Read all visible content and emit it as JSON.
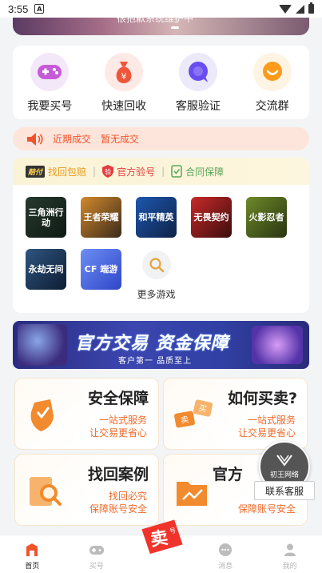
{
  "status_bar": {
    "time": "3:55",
    "notification_icon": "A"
  },
  "hero": {
    "text": "很抱歉系统维护中",
    "indicator": "carousel-dot"
  },
  "quick_actions": [
    {
      "label": "我要买号",
      "icon": "gamepad-icon",
      "color": "#c55bd8"
    },
    {
      "label": "快速回收",
      "icon": "money-bag-icon",
      "color": "#f0553a"
    },
    {
      "label": "客服验证",
      "icon": "chat-bubble-icon",
      "color": "#6a4cf0"
    },
    {
      "label": "交流群",
      "icon": "smile-chat-icon",
      "color": "#fb9b1c"
    }
  ],
  "recent_deals": {
    "label": "近期成交",
    "status": "暂无成交"
  },
  "guarantee": {
    "tag": "赔付",
    "items": [
      "找回包赔",
      "官方验号",
      "合同保障"
    ]
  },
  "games": [
    {
      "name": "三角洲行动",
      "color": "#1d2b24"
    },
    {
      "name": "王者荣耀",
      "color": "#3a2a1c"
    },
    {
      "name": "和平精英",
      "color": "#16305a"
    },
    {
      "name": "无畏契约",
      "color": "#7a1b1b"
    },
    {
      "name": "火影忍者",
      "color": "#3a4a1d"
    },
    {
      "name": "永劫无间",
      "color": "#1e3552"
    },
    {
      "name": "CF 端游",
      "color": "#3a5bd8"
    }
  ],
  "more_games": {
    "label": "更多游戏",
    "icon": "search-icon"
  },
  "banner": {
    "title": "官方交易 资金保障",
    "subtitle": "客户第一 品质至上"
  },
  "info_cards": [
    {
      "title": "安全保障",
      "line1": "一站式服务",
      "line2": "让交易更省心",
      "icon": "shield-icon"
    },
    {
      "title": "如何买卖?",
      "line1": "一站式服务",
      "line2": "让交易更省心",
      "icon": "trade-icon"
    },
    {
      "title": "找回案例",
      "line1": "找回必究",
      "line2": "保障账号安全",
      "icon": "magnifier-doc-icon"
    },
    {
      "title": "官方",
      "line1": "",
      "line2": "保障账号安全",
      "icon": "folder-icon"
    }
  ],
  "floating_service": {
    "logo_text": "初王网络",
    "button": "联系客服"
  },
  "tabbar": {
    "items": [
      {
        "label": "首页",
        "icon": "home-icon"
      },
      {
        "label": "买号",
        "icon": "gamepad-icon"
      },
      {
        "label": "卖号",
        "icon": "sell-badge-icon"
      },
      {
        "label": "消息",
        "icon": "message-icon"
      },
      {
        "label": "我的",
        "icon": "user-icon"
      }
    ],
    "active_index": 0,
    "center_badge": "卖号"
  },
  "colors": {
    "accent": "#f0542b",
    "background": "#f3f4f6"
  }
}
